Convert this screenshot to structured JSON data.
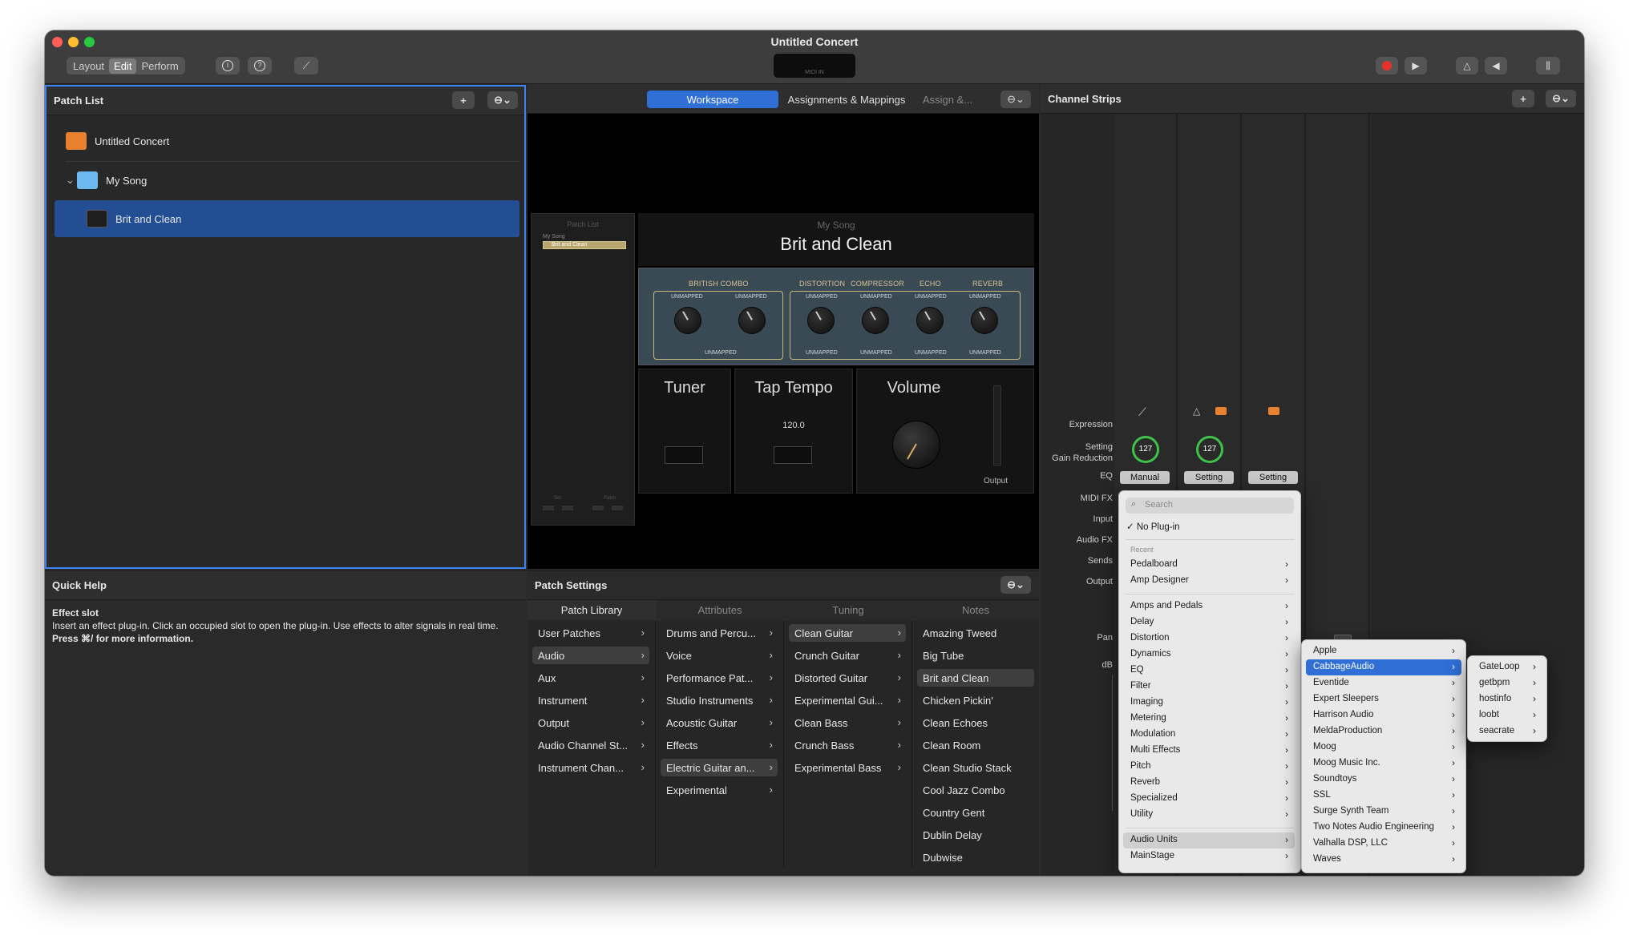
{
  "window": {
    "title": "Untitled Concert",
    "lcd_label": "MIDI IN"
  },
  "toolbar": {
    "modes": [
      "Layout",
      "Edit",
      "Perform"
    ],
    "active_mode": "Edit",
    "info_icon": "info-icon",
    "help_icon": "help-icon",
    "tuner_icon": "tuning-fork-icon"
  },
  "patch_list": {
    "title": "Patch List",
    "add_label": "+",
    "items": [
      {
        "label": "Untitled Concert",
        "icon": "concert-icon"
      },
      {
        "label": "My Song",
        "icon": "folder-icon",
        "disclosure": "⌄"
      },
      {
        "label": "Brit and Clean",
        "icon": "amp-icon"
      }
    ]
  },
  "quick_help": {
    "title": "Quick Help",
    "heading": "Effect slot",
    "body": "Insert an effect plug-in. Click an occupied slot to open the plug-in. Use effects to alter signals in real time.",
    "hint": "Press ⌘/ for more information."
  },
  "workspace": {
    "tabs": [
      "Workspace",
      "Assignments & Mappings",
      "Assign &..."
    ],
    "active_tab": "Workspace",
    "mini_patch_list": {
      "title": "Patch List",
      "song": "My Song",
      "patch": "Brit and Clean",
      "set_label": "Set",
      "patch_label": "Patch"
    },
    "song_label": "My Song",
    "patch_title": "Brit and Clean",
    "fx_sections": [
      "BRITISH COMBO",
      "DISTORTION",
      "COMPRESSOR",
      "ECHO",
      "REVERB"
    ],
    "unmapped": "UNMAPPED",
    "tuner_label": "Tuner",
    "tap_tempo_label": "Tap Tempo",
    "tempo_value": "120.0",
    "volume_label": "Volume",
    "output_label": "Output"
  },
  "patch_settings": {
    "title": "Patch Settings",
    "columns": [
      "Patch Library",
      "Attributes",
      "Tuning",
      "Notes"
    ],
    "col1": [
      "User Patches",
      "Audio",
      "Aux",
      "Instrument",
      "Output",
      "Audio Channel St...",
      "Instrument Chan..."
    ],
    "col1_selected": "Audio",
    "col2": [
      "Drums and Percu...",
      "Voice",
      "Performance Pat...",
      "Studio Instruments",
      "Acoustic Guitar",
      "Effects",
      "Electric Guitar an...",
      "Experimental"
    ],
    "col2_selected": "Electric Guitar an...",
    "col3": [
      "Clean Guitar",
      "Crunch Guitar",
      "Distorted Guitar",
      "Experimental Gui...",
      "Clean Bass",
      "Crunch Bass",
      "Experimental Bass"
    ],
    "col3_selected": "Clean Guitar",
    "col4": [
      "Amazing Tweed",
      "Big Tube",
      "Brit and Clean",
      "Chicken Pickin'",
      "Clean Echoes",
      "Clean Room",
      "Clean Studio Stack",
      "Cool Jazz Combo",
      "Country Gent",
      "Dublin Delay",
      "Dubwise"
    ],
    "col4_selected": "Brit and Clean"
  },
  "channel_strips": {
    "title": "Channel Strips",
    "add_label": "+",
    "row_labels": [
      "Expression",
      "Setting",
      "Gain Reduction",
      "EQ",
      "MIDI FX",
      "Input",
      "Audio FX",
      "Sends",
      "Output",
      "Pan",
      "dB"
    ],
    "expression_values": [
      "127",
      "127"
    ],
    "setting_buttons": [
      "Manual",
      "Setting",
      "Setting"
    ]
  },
  "plugin_menu": {
    "search_placeholder": "Search",
    "no_plugin": "No Plug-in",
    "checkmark": "✓",
    "recent_header": "Recent",
    "recent": [
      "Pedalboard",
      "Amp Designer"
    ],
    "categories": [
      "Amps and Pedals",
      "Delay",
      "Distortion",
      "Dynamics",
      "EQ",
      "Filter",
      "Imaging",
      "Metering",
      "Modulation",
      "Multi Effects",
      "Pitch",
      "Reverb",
      "Specialized",
      "Utility"
    ],
    "bottom": [
      "Audio Units",
      "MainStage"
    ],
    "highlighted": "Audio Units"
  },
  "au_menu": {
    "items": [
      "Apple",
      "CabbageAudio",
      "Eventide",
      "Expert Sleepers",
      "Harrison Audio",
      "MeldaProduction",
      "Moog",
      "Moog Music Inc.",
      "Soundtoys",
      "SSL",
      "Surge Synth Team",
      "Two Notes Audio Engineering",
      "Valhalla DSP, LLC",
      "Waves"
    ],
    "selected": "CabbageAudio"
  },
  "cabbage_menu": {
    "items": [
      "GateLoop",
      "getbpm",
      "hostinfo",
      "loobt",
      "seacrate"
    ]
  }
}
